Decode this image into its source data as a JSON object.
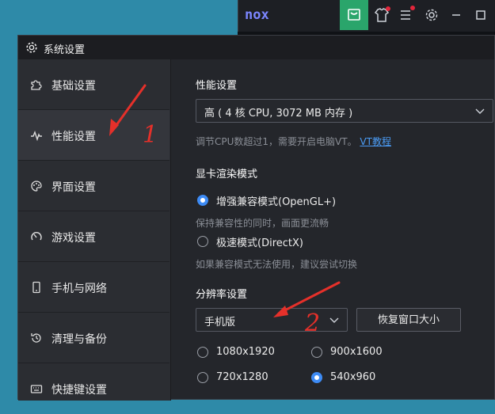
{
  "emulator": {
    "logo": "nox"
  },
  "dialog": {
    "title": "系统设置"
  },
  "sidebar": {
    "items": [
      {
        "label": "基础设置",
        "icon": "puzzle-icon"
      },
      {
        "label": "性能设置",
        "icon": "pulse-icon"
      },
      {
        "label": "界面设置",
        "icon": "palette-icon"
      },
      {
        "label": "游戏设置",
        "icon": "gauge-icon"
      },
      {
        "label": "手机与网络",
        "icon": "phone-icon"
      },
      {
        "label": "清理与备份",
        "icon": "history-icon"
      },
      {
        "label": "快捷键设置",
        "icon": "keyboard-icon"
      }
    ],
    "active_index": 1
  },
  "performance": {
    "title": "性能设置",
    "selected": "高 ( 4 核 CPU, 3072 MB 内存 )",
    "hint": "调节CPU数超过1，需要开启电脑VT。",
    "hint_link": "VT教程"
  },
  "render": {
    "title": "显卡渲染模式",
    "options": [
      {
        "label": "增强兼容模式(OpenGL+)",
        "selected": true,
        "desc": "保持兼容性的同时，画面更流畅"
      },
      {
        "label": "极速模式(DirectX)",
        "selected": false,
        "desc": "如果兼容模式无法使用，建议尝试切换"
      }
    ]
  },
  "resolution": {
    "title": "分辨率设置",
    "selected": "手机版",
    "restore_button": "恢复窗口大小",
    "options": [
      {
        "label": "1080x1920",
        "selected": false
      },
      {
        "label": "900x1600",
        "selected": false
      },
      {
        "label": "720x1280",
        "selected": false
      },
      {
        "label": "540x960",
        "selected": true
      }
    ]
  },
  "annotations": {
    "mark1": "1",
    "mark2": "2",
    "color": "#e5302a"
  },
  "colors": {
    "accent": "#3d8bf5",
    "link": "#4b9cf5",
    "store_green": "#2aa56b",
    "notify_red": "#e3263b"
  }
}
